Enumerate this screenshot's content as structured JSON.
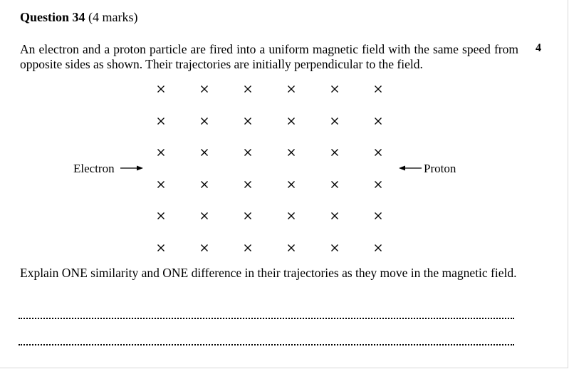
{
  "question": {
    "number_label": "Question 34",
    "marks_label": "(4 marks)",
    "side_marks": "4",
    "stem": "An electron and a proton particle are fired into a uniform magnetic field with the same speed from opposite sides as shown. Their trajectories are initially perpendicular to the field.",
    "prompt": "Explain ONE similarity and ONE difference in their trajectories as they move in the magnetic field."
  },
  "diagram": {
    "field_symbol": "×",
    "field_rows": 6,
    "field_cols": 6,
    "left_label": "Electron",
    "right_label": "Proton"
  },
  "answer_lines": 2
}
